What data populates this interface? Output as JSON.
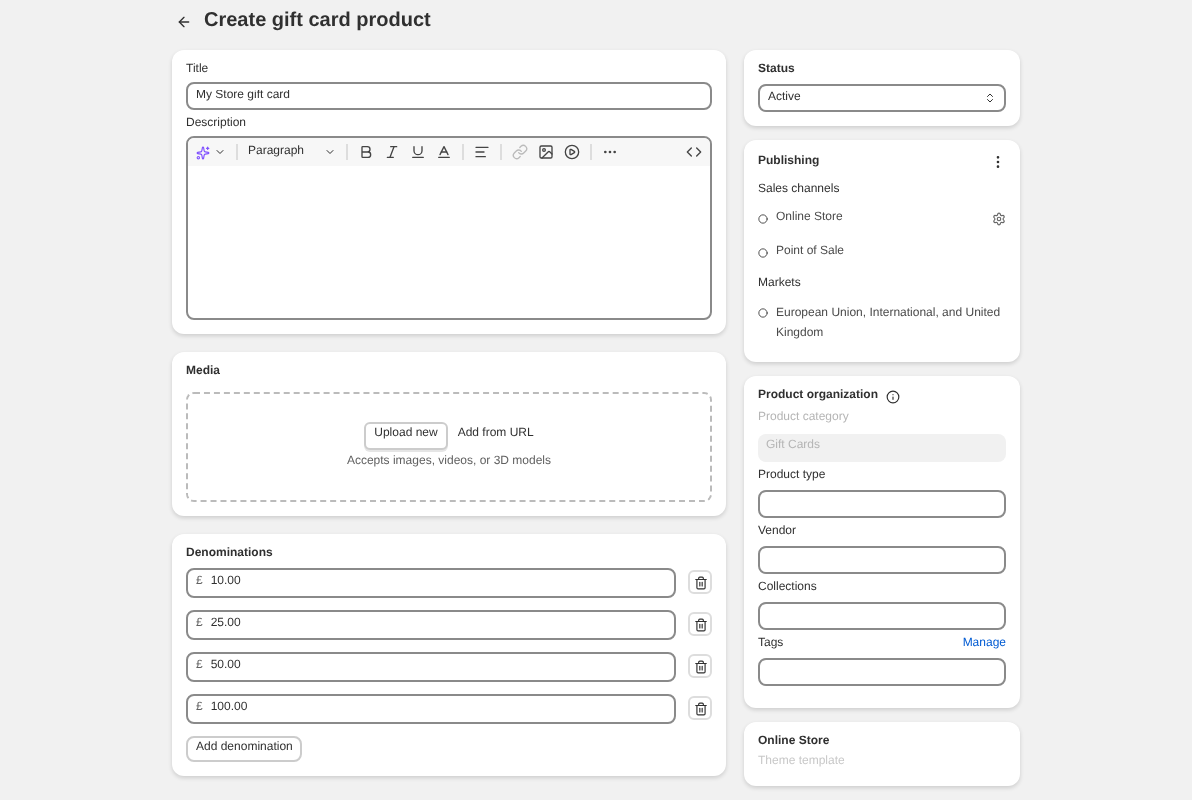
{
  "header": {
    "title": "Create gift card product"
  },
  "title_field": {
    "label": "Title",
    "value": "My Store gift card"
  },
  "description": {
    "label": "Description",
    "paragraph_style": "Paragraph"
  },
  "media": {
    "title": "Media",
    "upload_button": "Upload new",
    "url_link": "Add from URL",
    "hint": "Accepts images, videos, or 3D models"
  },
  "denominations": {
    "title": "Denominations",
    "items": [
      {
        "currency": "£",
        "value": "10.00"
      },
      {
        "currency": "£",
        "value": "25.00"
      },
      {
        "currency": "£",
        "value": "50.00"
      },
      {
        "currency": "£",
        "value": "100.00"
      }
    ],
    "add_button": "Add denomination"
  },
  "status": {
    "label": "Status",
    "value": "Active"
  },
  "publishing": {
    "title": "Publishing",
    "sales_channels_label": "Sales channels",
    "channels": [
      "Online Store",
      "Point of Sale"
    ],
    "markets_label": "Markets",
    "markets": [
      "European Union, International, and United Kingdom"
    ]
  },
  "product_organization": {
    "title": "Product organization",
    "fields": [
      {
        "label": "Product category",
        "value": "Gift Cards",
        "disabled": true
      },
      {
        "label": "Product type",
        "disabled": false
      },
      {
        "label": "Vendor",
        "disabled": false
      },
      {
        "label": "Collections",
        "disabled": false
      },
      {
        "label": "Tags",
        "action": "Manage",
        "disabled": false
      }
    ]
  },
  "online_store": {
    "title": "Online Store",
    "field_label": "Theme template"
  }
}
